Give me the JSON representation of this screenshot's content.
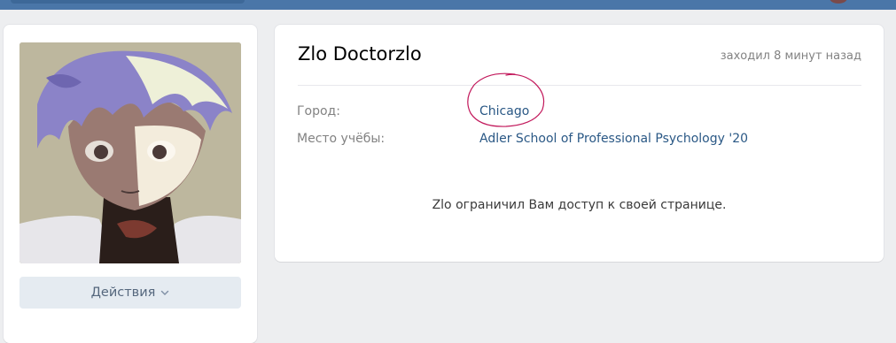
{
  "header": {
    "brand_color": "#4a76a8"
  },
  "sidebar": {
    "avatar_icon": "profile-photo",
    "actions_button_label": "Действия",
    "actions_chevron_icon": "chevron-down-icon"
  },
  "profile": {
    "name": "Zlo Doctorzlo",
    "last_seen": "заходил 8 минут назад",
    "info": [
      {
        "label": "Город:",
        "value": "Chicago"
      },
      {
        "label": "Место учёбы:",
        "value": "Adler School of Professional Psychology '20"
      }
    ],
    "restricted_message": "Zlo ограничил Вам доступ к своей странице.",
    "annotation_color": "#c2185b"
  }
}
